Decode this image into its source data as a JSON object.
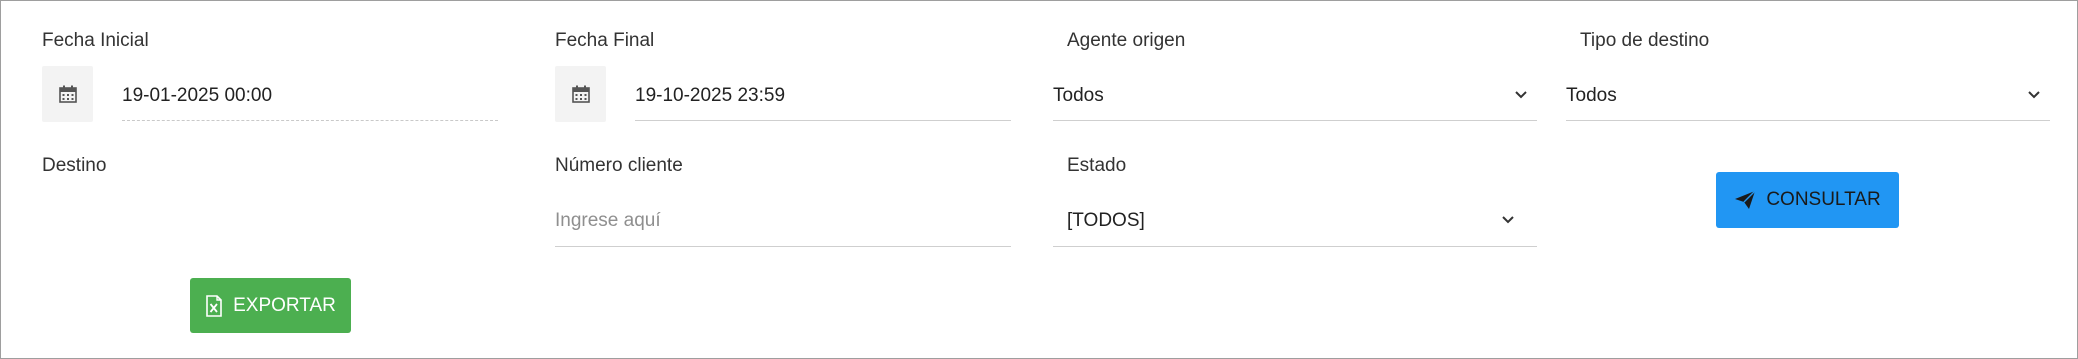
{
  "filters": {
    "fecha_inicial": {
      "label": "Fecha Inicial",
      "value": "19-01-2025 00:00"
    },
    "fecha_final": {
      "label": "Fecha Final",
      "value": "19-10-2025 23:59"
    },
    "agente_origen": {
      "label": "Agente origen",
      "value": "Todos"
    },
    "tipo_destino": {
      "label": "Tipo de destino",
      "value": "Todos"
    },
    "destino": {
      "label": "Destino"
    },
    "numero_cliente": {
      "label": "Número cliente",
      "placeholder": "Ingrese aquí"
    },
    "estado": {
      "label": "Estado",
      "value": "[TODOS]"
    }
  },
  "actions": {
    "consultar_label": "CONSULTAR",
    "exportar_label": "EXPORTAR"
  },
  "icons": {
    "calendar": "calendar-icon",
    "chevron": "chevron-down-icon",
    "send": "paper-plane-icon",
    "excel": "excel-file-icon"
  },
  "colors": {
    "consultar_bg": "#2196f3",
    "exportar_bg": "#4caf50"
  }
}
